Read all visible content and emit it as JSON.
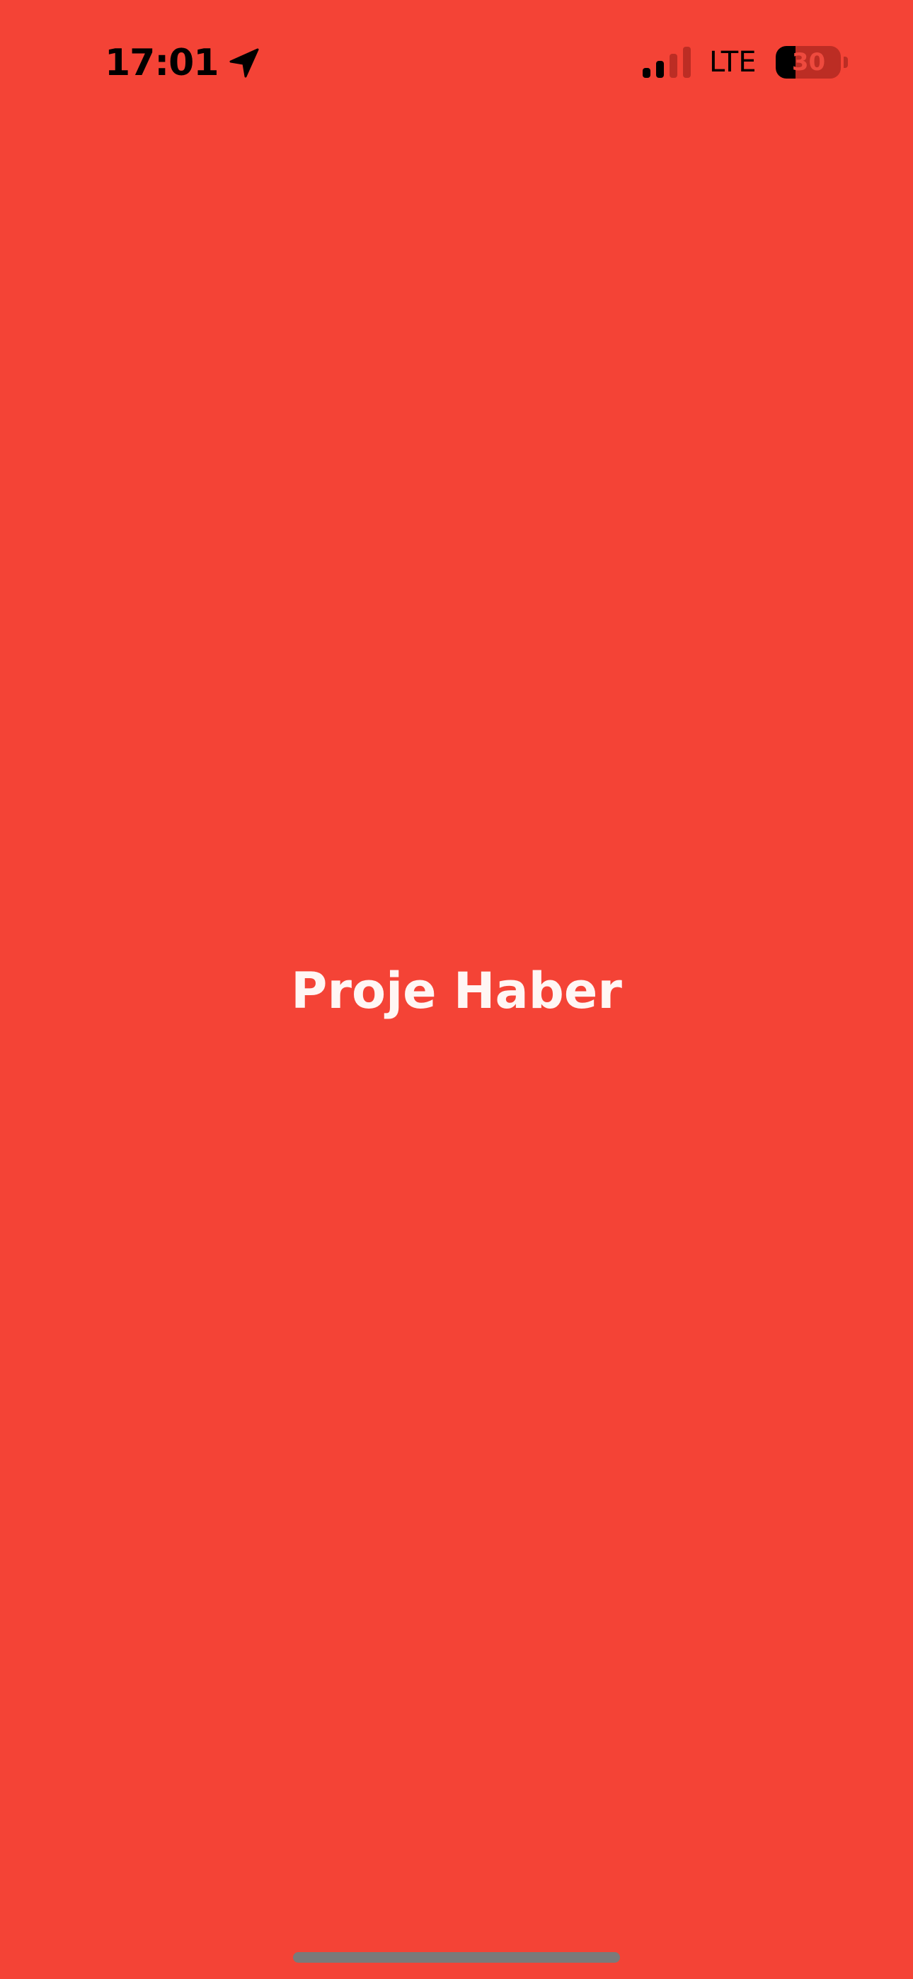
{
  "status_bar": {
    "time": "17:01",
    "location_icon": "location-arrow-icon",
    "signal_icon": "cellular-signal-icon",
    "signal_bars_active": 2,
    "signal_bars_total": 4,
    "network": "LTE",
    "battery_level": "30",
    "battery_fraction": 0.3
  },
  "splash": {
    "title": "Proje Haber"
  },
  "colors": {
    "background": "#F44336",
    "title_text": "#FFF6F4",
    "status_text": "#000000",
    "home_indicator": "#7A7A7A"
  }
}
